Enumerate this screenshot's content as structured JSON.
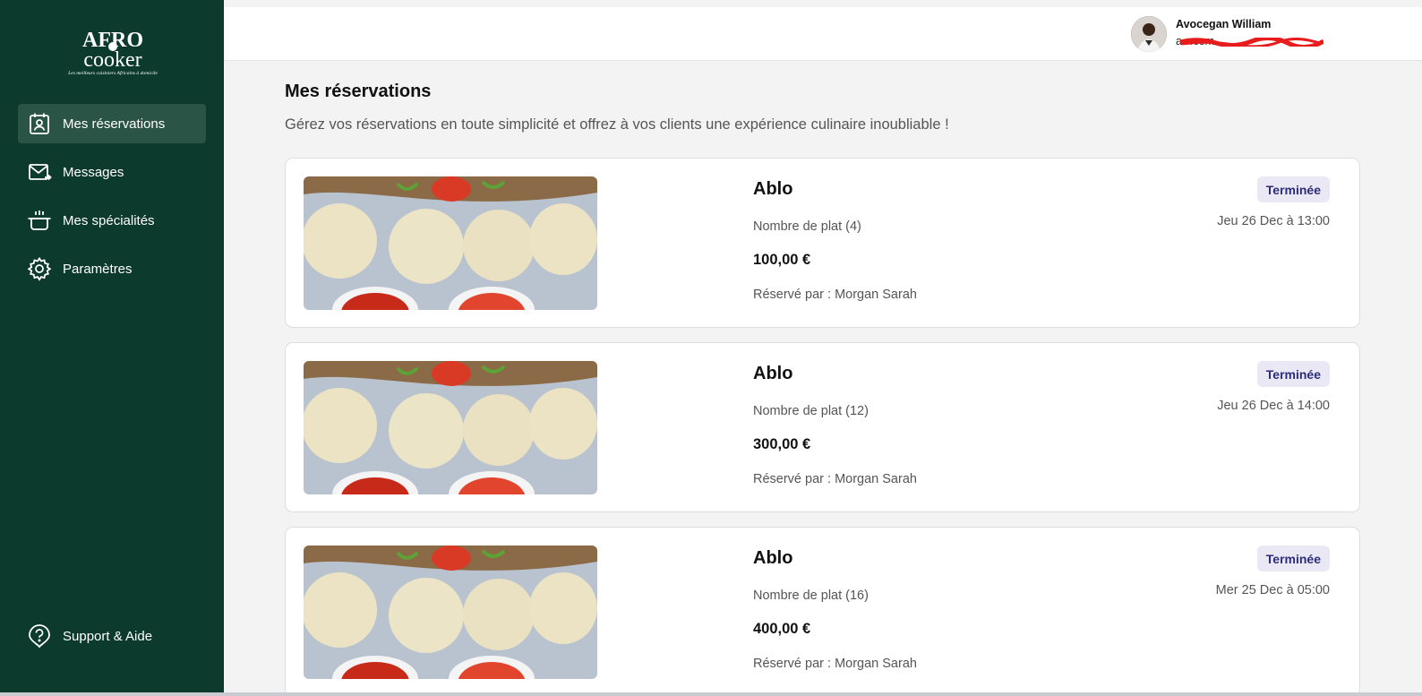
{
  "brand": {
    "logo_top": "AFRO",
    "logo_bottom": "cooker",
    "tagline": "Les meilleurs cuisiniers Africains à domicile"
  },
  "sidebar": {
    "items": [
      {
        "label": "Mes réservations",
        "icon": "calendar-user-icon",
        "active": true
      },
      {
        "label": "Messages",
        "icon": "mail-icon",
        "active": false
      },
      {
        "label": "Mes spécialités",
        "icon": "pot-icon",
        "active": false
      },
      {
        "label": "Paramètres",
        "icon": "gear-icon",
        "active": false
      }
    ],
    "support_label": "Support & Aide"
  },
  "user": {
    "name": "Avocegan William",
    "email": "a…com"
  },
  "page": {
    "title": "Mes réservations",
    "subtitle": "Gérez vos réservations en toute simplicité et offrez à vos clients une expérience culinaire inoubliable !"
  },
  "reservations": [
    {
      "dish": "Ablo",
      "count": "Nombre de plat (4)",
      "price": "100,00 €",
      "booked_by": "Réservé par : Morgan  Sarah",
      "status": "Terminée",
      "date": "Jeu 26 Dec à 13:00"
    },
    {
      "dish": "Ablo",
      "count": "Nombre de plat (12)",
      "price": "300,00 €",
      "booked_by": "Réservé par : Morgan  Sarah",
      "status": "Terminée",
      "date": "Jeu 26 Dec à 14:00"
    },
    {
      "dish": "Ablo",
      "count": "Nombre de plat (16)",
      "price": "400,00 €",
      "booked_by": "Réservé par : Morgan  Sarah",
      "status": "Terminée",
      "date": "Mer 25 Dec à 05:00"
    }
  ],
  "colors": {
    "sidebar": "#0c3a2c",
    "active_item": "#2a5546",
    "badge_bg": "#eae8f5",
    "badge_text": "#2c2d78"
  }
}
